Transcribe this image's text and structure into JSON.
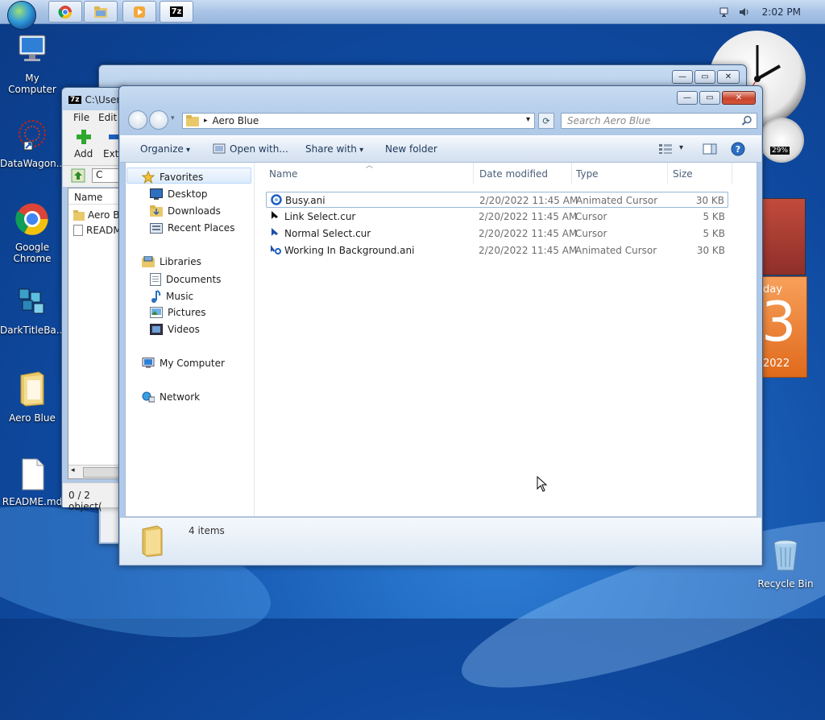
{
  "taskbar": {
    "clock": "2:02 PM",
    "buttons": [
      {
        "name": "chrome-task",
        "icon": "chrome-icon"
      },
      {
        "name": "explorer-task",
        "icon": "folder-icon"
      },
      {
        "name": "media-task",
        "icon": "media-player-icon"
      },
      {
        "name": "7zip-task",
        "icon": "7zip-icon",
        "label": "7z"
      }
    ]
  },
  "desktop": {
    "icons": [
      {
        "label": "My Computer"
      },
      {
        "label": "DataWagon..."
      },
      {
        "label": "Google Chrome"
      },
      {
        "label": "DarkTitleBa..."
      },
      {
        "label": "Aero Blue"
      },
      {
        "label": "README.md"
      },
      {
        "label": "Recycle Bin"
      }
    ],
    "gadgets": {
      "cpu_percent": "29%",
      "calendar_day_partial": "day",
      "calendar_date_partial": "3",
      "calendar_year_partial": "2022"
    }
  },
  "zip_window": {
    "title": "C:\\Users",
    "menu": [
      "File",
      "Edit"
    ],
    "toolbar": [
      "Add",
      "Extr"
    ],
    "path_fragment": "C",
    "column": "Name",
    "items": [
      "Aero Bl",
      "READM"
    ],
    "status": "0 / 2 object("
  },
  "explorer": {
    "address": "Aero Blue",
    "search_placeholder": "Search Aero Blue",
    "commands": {
      "organize": "Organize",
      "open_with": "Open with...",
      "share_with": "Share with",
      "new_folder": "New folder"
    },
    "nav": {
      "favorites": "Favorites",
      "desktop": "Desktop",
      "downloads": "Downloads",
      "recent": "Recent Places",
      "libraries": "Libraries",
      "documents": "Documents",
      "music": "Music",
      "pictures": "Pictures",
      "videos": "Videos",
      "computer": "My Computer",
      "network": "Network"
    },
    "columns": {
      "name": "Name",
      "date": "Date modified",
      "type": "Type",
      "size": "Size"
    },
    "files": [
      {
        "name": "Busy.ani",
        "date": "2/20/2022 11:45 AM",
        "type": "Animated Cursor",
        "size": "30 KB"
      },
      {
        "name": "Link Select.cur",
        "date": "2/20/2022 11:45 AM",
        "type": "Cursor",
        "size": "5 KB"
      },
      {
        "name": "Normal Select.cur",
        "date": "2/20/2022 11:45 AM",
        "type": "Cursor",
        "size": "5 KB"
      },
      {
        "name": "Working In Background.ani",
        "date": "2/20/2022 11:45 AM",
        "type": "Animated Cursor",
        "size": "30 KB"
      }
    ],
    "details_count": "4 items"
  }
}
